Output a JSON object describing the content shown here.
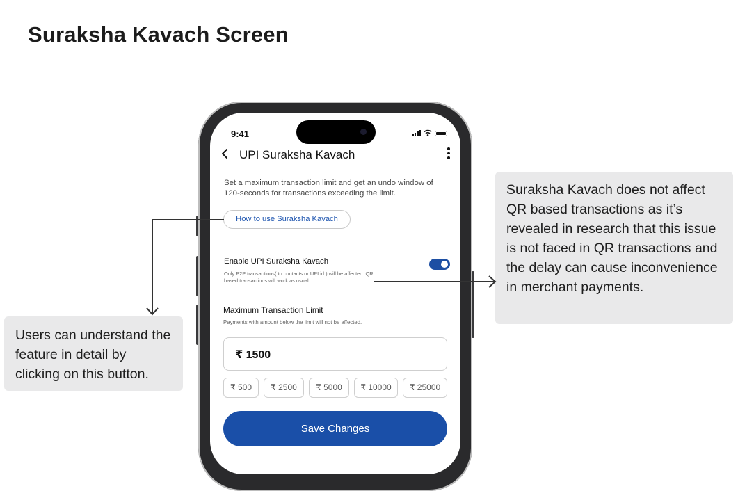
{
  "page": {
    "title": "Suraksha Kavach Screen"
  },
  "phone": {
    "status_bar": {
      "time": "9:41"
    },
    "header": {
      "back_icon": "chevron-left-icon",
      "title": "UPI Suraksha Kavach",
      "more_icon": "more-vertical-icon"
    },
    "description": "Set a maximum transaction limit and get an undo window of 120-seconds for transactions exceeding the limit.",
    "how_to_label": "How to use Suraksha Kavach",
    "enable": {
      "title": "Enable UPI Suraksha Kavach",
      "subtitle": "Only P2P transactions( to contacts or UPI id ) will be affected. QR based transactions will work as usual.",
      "toggle_on": true
    },
    "limit": {
      "title": "Maximum Transaction Limit",
      "subtitle": "Payments with amount below the limit will not be affected.",
      "value": "₹ 1500",
      "chips": [
        "₹ 500",
        "₹ 2500",
        "₹ 5000",
        "₹ 10000",
        "₹ 25000"
      ]
    },
    "save_label": "Save Changes"
  },
  "callouts": {
    "left": "Users can understand the feature in detail by clicking on this button.",
    "right": "Suraksha Kavach does not affect QR based transactions as it’s revealed in research that this issue is not faced in QR transactions and the delay can cause inconvenience in merchant payments."
  },
  "colors": {
    "accent": "#1a4fa8",
    "callout_bg": "#e9e9ea",
    "link": "#1f56b0"
  }
}
